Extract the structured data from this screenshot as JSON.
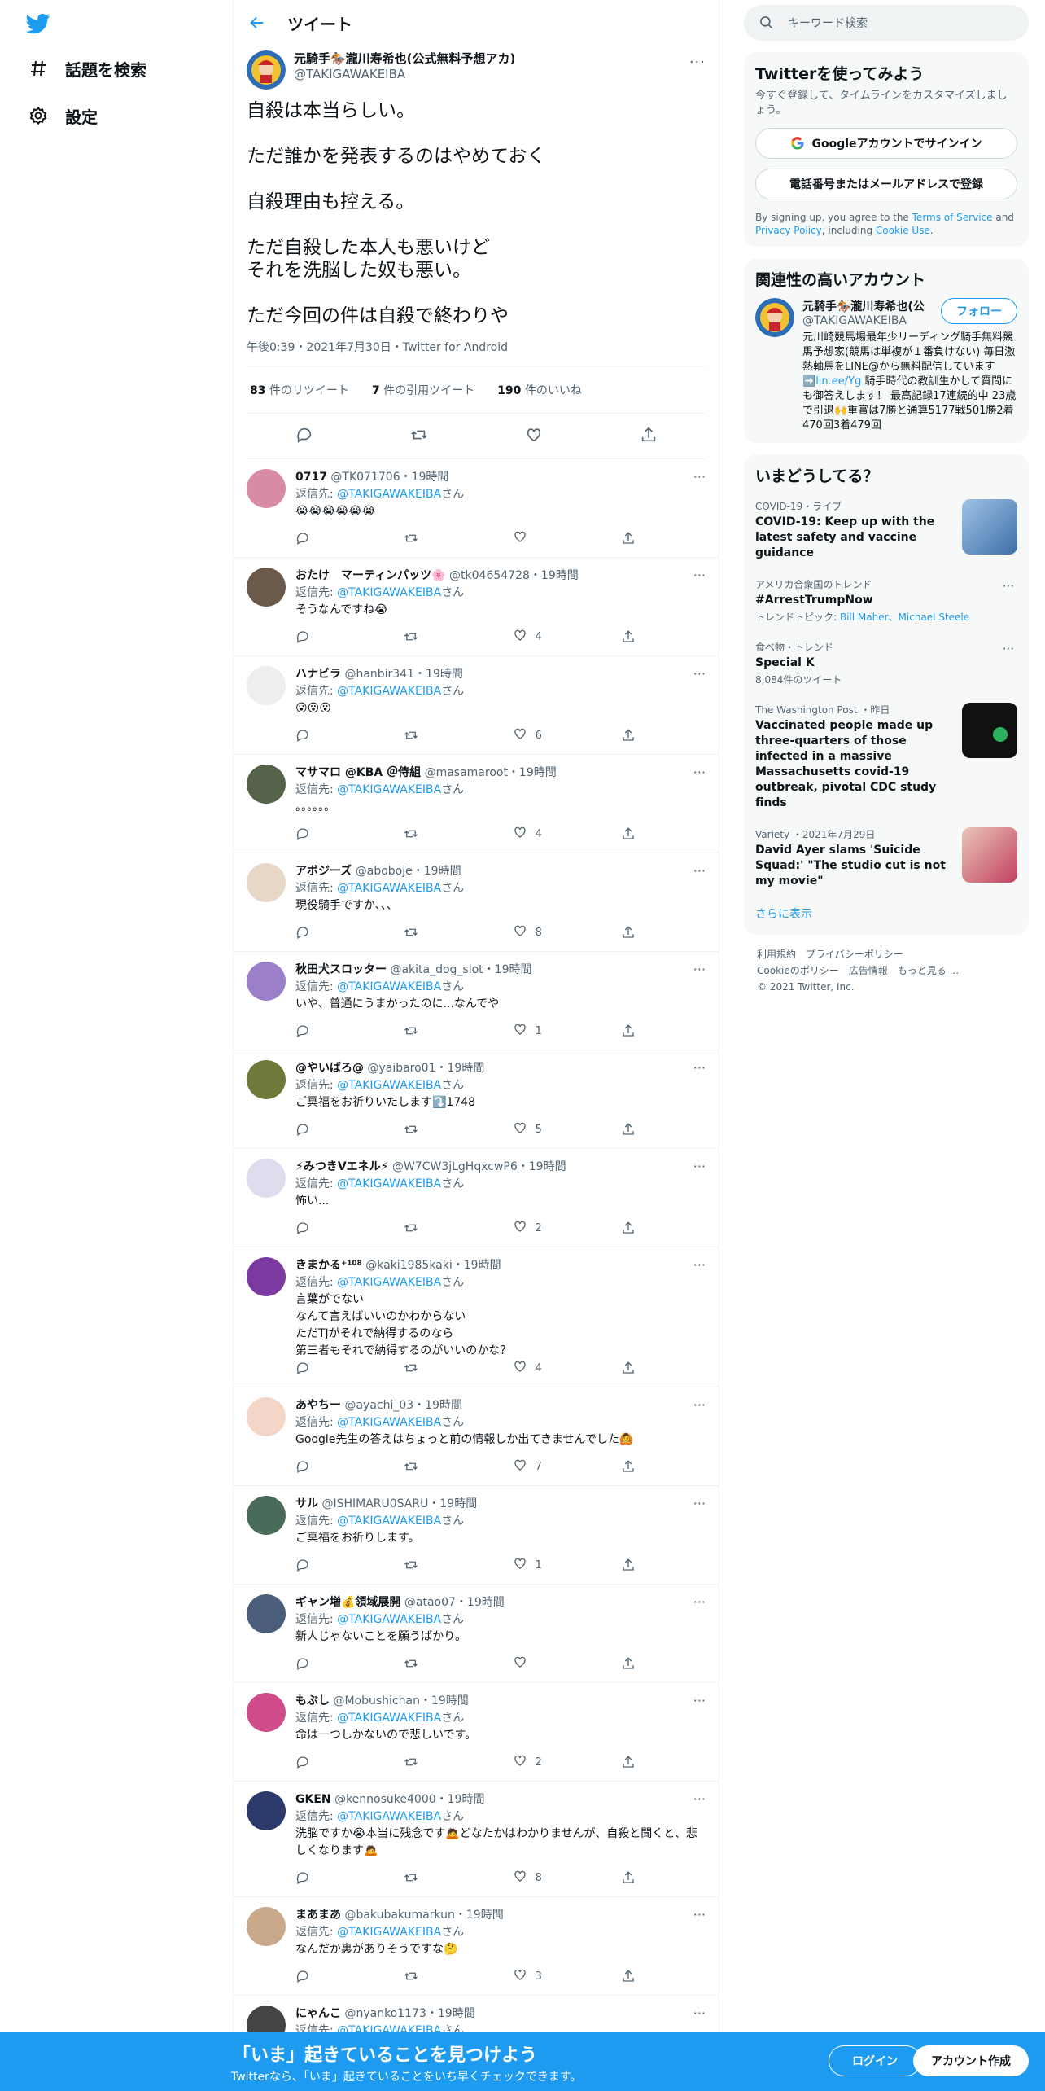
{
  "nav": {
    "explore": "話題を検索",
    "settings": "設定"
  },
  "header": {
    "title": "ツイート"
  },
  "main_tweet": {
    "name": "元騎手🏇瀧川寿希也(公式無料予想アカ)",
    "handle": "@TAKIGAWAKEIBA",
    "text": "自殺は本当らしい。\n\nただ誰かを発表するのはやめておく\n\n自殺理由も控える。\n\nただ自殺した本人も悪いけど\nそれを洗脳した奴も悪い。\n\nただ今回の件は自殺で終わりや",
    "meta": "午後0:39・2021年7月30日・Twitter for Android",
    "retweets_num": "83",
    "retweets_label": " 件のリツイート",
    "quotes_num": "7",
    "quotes_label": " 件の引用ツイート",
    "likes_num": "190",
    "likes_label": " 件のいいね"
  },
  "reply_to_label": "返信先: ",
  "reply_to_handle": "@TAKIGAWAKEIBA",
  "reply_to_suffix": "さん",
  "replies": [
    {
      "name": "0717",
      "handle": "@TK071706",
      "time": "・19時間",
      "text": "😭😭😭😭😭😭",
      "likes": ""
    },
    {
      "name": "おたけ　マーティンパッツ🌸",
      "handle": "@tk04654728",
      "time": "・19時間",
      "text": "そうなんですね😭",
      "likes": "4"
    },
    {
      "name": "ハナビラ",
      "handle": "@hanbir341",
      "time": "・19時間",
      "text": "😮😮😮",
      "likes": "6"
    },
    {
      "name": "マサマロ @KBA ＠侍組",
      "handle": "@masamaroot",
      "time": "・19時間",
      "text": "。。。。。。",
      "likes": "4"
    },
    {
      "name": "アボジーズ",
      "handle": "@aboboje",
      "time": "・19時間",
      "text": "現役騎手ですか、、、",
      "likes": "8"
    },
    {
      "name": "秋田犬スロッター",
      "handle": "@akita_dog_slot",
      "time": "・19時間",
      "text": "いや、普通にうまかったのに...なんでや",
      "likes": "1"
    },
    {
      "name": "@やいばろ@",
      "handle": "@yaibaro01",
      "time": "・19時間",
      "text": "ご冥福をお祈りいたします⤵️1748",
      "likes": "5"
    },
    {
      "name": "⚡みつきVエネル⚡",
      "handle": "@W7CW3jLgHqxcwP6",
      "time": "・19時間",
      "text": "怖い...",
      "likes": "2"
    },
    {
      "name": "きまかる⁺¹⁰⁸",
      "handle": "@kaki1985kaki",
      "time": "・19時間",
      "text": "言葉がでない\nなんて言えばいいのかわからない\nただTJがそれで納得するのなら\n第三者もそれで納得するのがいいのかな？",
      "likes": "4"
    },
    {
      "name": "あやちー",
      "handle": "@ayachi_03",
      "time": "・19時間",
      "text": "Google先生の答えはちょっと前の情報しか出てきませんでした🙆",
      "likes": "7"
    },
    {
      "name": "サル",
      "handle": "@ISHIMARU0SARU",
      "time": "・19時間",
      "text": "ご冥福をお祈りします。",
      "likes": "1"
    },
    {
      "name": "ギャン増💰領域展開",
      "handle": "@atao07",
      "time": "・19時間",
      "text": "新人じゃないことを願うばかり。",
      "likes": ""
    },
    {
      "name": "もぶし",
      "handle": "@Mobushichan",
      "time": "・19時間",
      "text": "命は一つしかないので悲しいです。",
      "likes": "2"
    },
    {
      "name": "GKEN",
      "handle": "@kennosuke4000",
      "time": "・19時間",
      "text": "洗脳ですか😭本当に残念です🙇どなたかはわかりませんが、自殺と聞くと、悲しくなります🙇",
      "likes": "8"
    },
    {
      "name": "まあまあ",
      "handle": "@bakubakumarkun",
      "time": "・19時間",
      "text": "なんだか裏がありそうですな🤔",
      "likes": "3"
    },
    {
      "name": "にゃんこ",
      "handle": "@nyanko1173",
      "time": "・19時間",
      "text": "",
      "likes": ""
    }
  ],
  "search": {
    "placeholder": "キーワード検索"
  },
  "signup_panel": {
    "title": "Twitterを使ってみよう",
    "subtitle": "今すぐ登録して、タイムラインをカスタマイズしましょう。",
    "google_btn": "Googleアカウントでサインイン",
    "phone_btn": "電話番号またはメールアドレスで登録",
    "legal_1": "By signing up, you agree to the ",
    "tos": "Terms of Service",
    "legal_2": " and ",
    "privacy": "Privacy Policy",
    "legal_3": ", including ",
    "cookie": "Cookie Use",
    "legal_4": "."
  },
  "related": {
    "title": "関連性の高いアカウント",
    "name": "元騎手🏇瀧川寿希也(公",
    "handle": "@TAKIGAWAKEIBA",
    "follow": "フォロー",
    "bio_1": "元川崎競馬場最年少リーディング騎手無料競馬予想家(競馬は単複が１番負けない) 毎日激熱軸馬をLINE@から無料配信しています➡️",
    "bio_link": "lin.ee/Yg",
    "bio_2": " 騎手時代の教訓生かして質問にも御答えします！ 最高記録17連続的中 23歳で引退🙌重賞は7勝と通算5177戦501勝2着470回3着479回"
  },
  "trends": {
    "title": "いまどうしてる？",
    "items": [
      {
        "ctx": "COVID-19・ライブ",
        "title": "COVID-19: Keep up with the latest safety and vaccine guidance",
        "sub": "",
        "thumb": "covid"
      },
      {
        "ctx": "アメリカ合衆国のトレンド",
        "title": "#ArrestTrumpNow",
        "sub": "トレンドトピック: ",
        "sub_links": "Bill Maher、Michael Steele",
        "thumb": ""
      },
      {
        "ctx": "食べ物・トレンド",
        "title": "Special K",
        "sub": "8,084件のツイート",
        "thumb": ""
      },
      {
        "ctx": "The Washington Post ・昨日",
        "title": "Vaccinated people made up three-quarters of those infected in a massive Massachusetts covid-19 outbreak, pivotal CDC study finds",
        "sub": "",
        "thumb": "wapo"
      },
      {
        "ctx": "Variety ・2021年7月29日",
        "title": "David Ayer slams 'Suicide Squad:' \"The studio cut is not my movie\"",
        "sub": "",
        "thumb": "variety"
      }
    ],
    "show_more": "さらに表示"
  },
  "footer": {
    "links_1": [
      "利用規約",
      "プライバシーポリシー"
    ],
    "links_2": [
      "Cookieのポリシー",
      "広告情報",
      "もっと見る ..."
    ],
    "copyright": "© 2021 Twitter, Inc."
  },
  "bottom_bar": {
    "title": "「いま」起きていることを見つけよう",
    "subtitle": "Twitterなら、「いま」起きていることをいち早くチェックできます。",
    "login": "ログイン",
    "signup": "アカウント作成"
  },
  "colors": {
    "accent": "#1d9bf0",
    "text": "#0f1419",
    "muted": "#536471"
  }
}
